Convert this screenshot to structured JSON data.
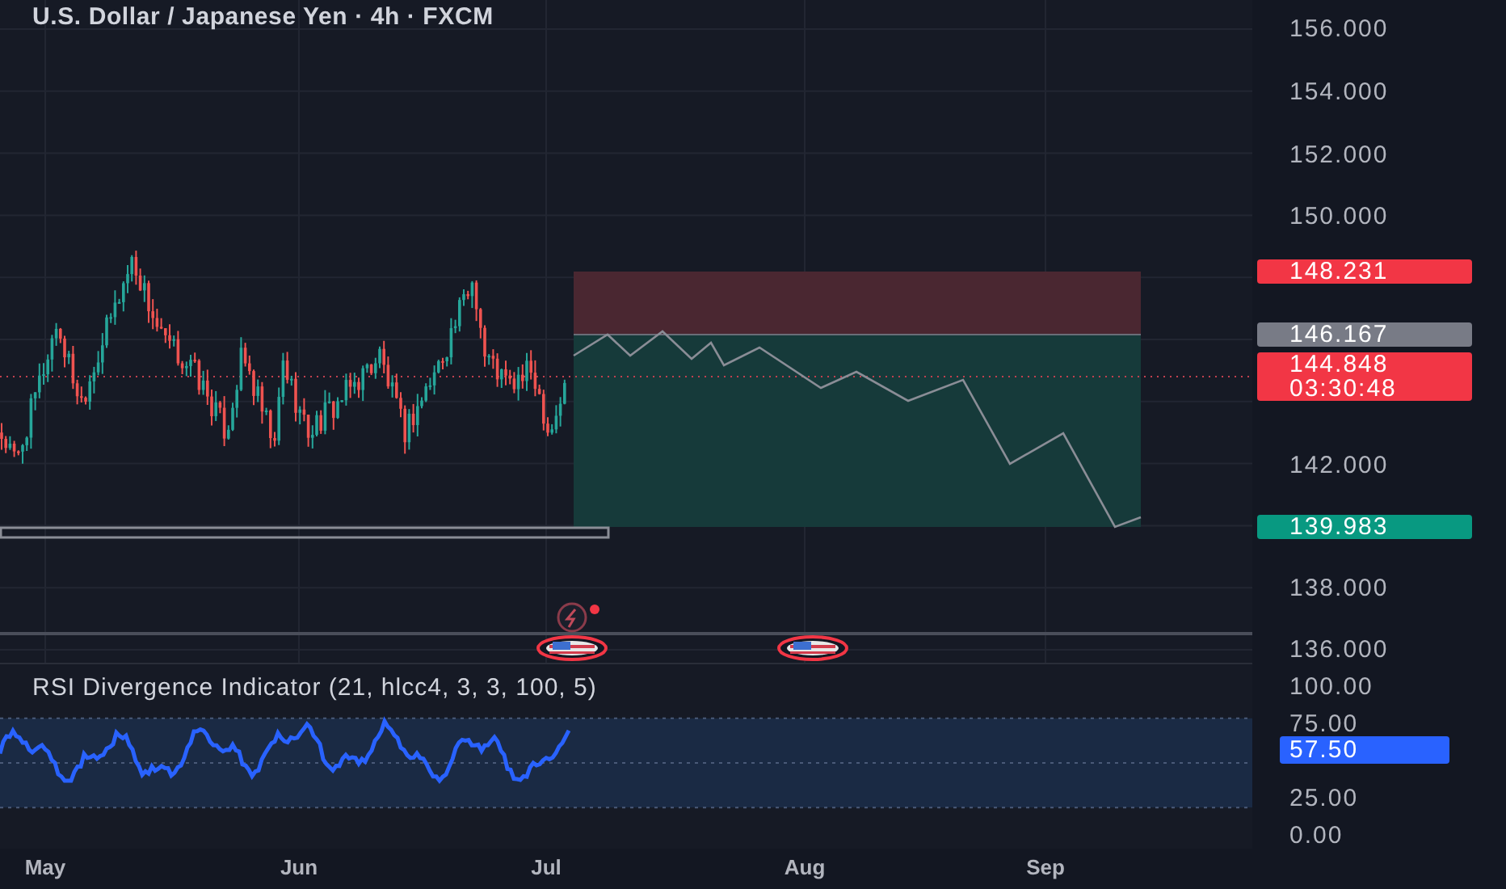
{
  "chart": {
    "title": "U.S. Dollar / Japanese Yen · 4h · FXCM"
  },
  "price_axis": {
    "labels": [
      "156.000",
      "154.000",
      "152.000",
      "150.000",
      "142.000",
      "138.000",
      "136.000"
    ]
  },
  "price_tags": [
    {
      "kind": "stop",
      "text": "148.231",
      "color": "#f23645"
    },
    {
      "kind": "entry",
      "text": "146.167",
      "color": "#787b86"
    },
    {
      "kind": "last",
      "text": "144.848",
      "countdown": "03:30:48",
      "color": "#f23645"
    },
    {
      "kind": "target",
      "text": "139.983",
      "color": "#089981"
    }
  ],
  "indicator": {
    "title": "RSI Divergence Indicator (21, hlcc4, 3, 3, 100, 5)",
    "axis_labels": [
      "100.00",
      "75.00",
      "25.00",
      "0.00"
    ],
    "value_tag": {
      "text": "57.50",
      "color": "#2962ff"
    }
  },
  "time_axis": {
    "labels": [
      "May",
      "Jun",
      "Jul",
      "Aug",
      "Sep"
    ]
  }
}
